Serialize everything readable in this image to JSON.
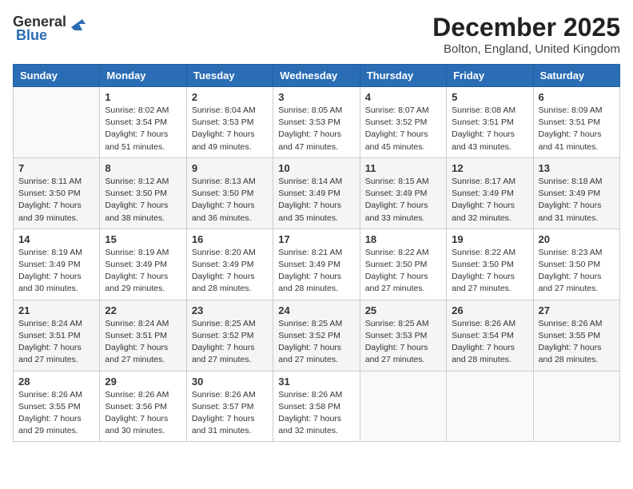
{
  "logo": {
    "general": "General",
    "blue": "Blue"
  },
  "title": "December 2025",
  "location": "Bolton, England, United Kingdom",
  "days": [
    "Sunday",
    "Monday",
    "Tuesday",
    "Wednesday",
    "Thursday",
    "Friday",
    "Saturday"
  ],
  "weeks": [
    [
      {
        "day": "",
        "sunrise": "",
        "sunset": "",
        "daylight": ""
      },
      {
        "day": "1",
        "sunrise": "Sunrise: 8:02 AM",
        "sunset": "Sunset: 3:54 PM",
        "daylight": "Daylight: 7 hours and 51 minutes."
      },
      {
        "day": "2",
        "sunrise": "Sunrise: 8:04 AM",
        "sunset": "Sunset: 3:53 PM",
        "daylight": "Daylight: 7 hours and 49 minutes."
      },
      {
        "day": "3",
        "sunrise": "Sunrise: 8:05 AM",
        "sunset": "Sunset: 3:53 PM",
        "daylight": "Daylight: 7 hours and 47 minutes."
      },
      {
        "day": "4",
        "sunrise": "Sunrise: 8:07 AM",
        "sunset": "Sunset: 3:52 PM",
        "daylight": "Daylight: 7 hours and 45 minutes."
      },
      {
        "day": "5",
        "sunrise": "Sunrise: 8:08 AM",
        "sunset": "Sunset: 3:51 PM",
        "daylight": "Daylight: 7 hours and 43 minutes."
      },
      {
        "day": "6",
        "sunrise": "Sunrise: 8:09 AM",
        "sunset": "Sunset: 3:51 PM",
        "daylight": "Daylight: 7 hours and 41 minutes."
      }
    ],
    [
      {
        "day": "7",
        "sunrise": "Sunrise: 8:11 AM",
        "sunset": "Sunset: 3:50 PM",
        "daylight": "Daylight: 7 hours and 39 minutes."
      },
      {
        "day": "8",
        "sunrise": "Sunrise: 8:12 AM",
        "sunset": "Sunset: 3:50 PM",
        "daylight": "Daylight: 7 hours and 38 minutes."
      },
      {
        "day": "9",
        "sunrise": "Sunrise: 8:13 AM",
        "sunset": "Sunset: 3:50 PM",
        "daylight": "Daylight: 7 hours and 36 minutes."
      },
      {
        "day": "10",
        "sunrise": "Sunrise: 8:14 AM",
        "sunset": "Sunset: 3:49 PM",
        "daylight": "Daylight: 7 hours and 35 minutes."
      },
      {
        "day": "11",
        "sunrise": "Sunrise: 8:15 AM",
        "sunset": "Sunset: 3:49 PM",
        "daylight": "Daylight: 7 hours and 33 minutes."
      },
      {
        "day": "12",
        "sunrise": "Sunrise: 8:17 AM",
        "sunset": "Sunset: 3:49 PM",
        "daylight": "Daylight: 7 hours and 32 minutes."
      },
      {
        "day": "13",
        "sunrise": "Sunrise: 8:18 AM",
        "sunset": "Sunset: 3:49 PM",
        "daylight": "Daylight: 7 hours and 31 minutes."
      }
    ],
    [
      {
        "day": "14",
        "sunrise": "Sunrise: 8:19 AM",
        "sunset": "Sunset: 3:49 PM",
        "daylight": "Daylight: 7 hours and 30 minutes."
      },
      {
        "day": "15",
        "sunrise": "Sunrise: 8:19 AM",
        "sunset": "Sunset: 3:49 PM",
        "daylight": "Daylight: 7 hours and 29 minutes."
      },
      {
        "day": "16",
        "sunrise": "Sunrise: 8:20 AM",
        "sunset": "Sunset: 3:49 PM",
        "daylight": "Daylight: 7 hours and 28 minutes."
      },
      {
        "day": "17",
        "sunrise": "Sunrise: 8:21 AM",
        "sunset": "Sunset: 3:49 PM",
        "daylight": "Daylight: 7 hours and 28 minutes."
      },
      {
        "day": "18",
        "sunrise": "Sunrise: 8:22 AM",
        "sunset": "Sunset: 3:50 PM",
        "daylight": "Daylight: 7 hours and 27 minutes."
      },
      {
        "day": "19",
        "sunrise": "Sunrise: 8:22 AM",
        "sunset": "Sunset: 3:50 PM",
        "daylight": "Daylight: 7 hours and 27 minutes."
      },
      {
        "day": "20",
        "sunrise": "Sunrise: 8:23 AM",
        "sunset": "Sunset: 3:50 PM",
        "daylight": "Daylight: 7 hours and 27 minutes."
      }
    ],
    [
      {
        "day": "21",
        "sunrise": "Sunrise: 8:24 AM",
        "sunset": "Sunset: 3:51 PM",
        "daylight": "Daylight: 7 hours and 27 minutes."
      },
      {
        "day": "22",
        "sunrise": "Sunrise: 8:24 AM",
        "sunset": "Sunset: 3:51 PM",
        "daylight": "Daylight: 7 hours and 27 minutes."
      },
      {
        "day": "23",
        "sunrise": "Sunrise: 8:25 AM",
        "sunset": "Sunset: 3:52 PM",
        "daylight": "Daylight: 7 hours and 27 minutes."
      },
      {
        "day": "24",
        "sunrise": "Sunrise: 8:25 AM",
        "sunset": "Sunset: 3:52 PM",
        "daylight": "Daylight: 7 hours and 27 minutes."
      },
      {
        "day": "25",
        "sunrise": "Sunrise: 8:25 AM",
        "sunset": "Sunset: 3:53 PM",
        "daylight": "Daylight: 7 hours and 27 minutes."
      },
      {
        "day": "26",
        "sunrise": "Sunrise: 8:26 AM",
        "sunset": "Sunset: 3:54 PM",
        "daylight": "Daylight: 7 hours and 28 minutes."
      },
      {
        "day": "27",
        "sunrise": "Sunrise: 8:26 AM",
        "sunset": "Sunset: 3:55 PM",
        "daylight": "Daylight: 7 hours and 28 minutes."
      }
    ],
    [
      {
        "day": "28",
        "sunrise": "Sunrise: 8:26 AM",
        "sunset": "Sunset: 3:55 PM",
        "daylight": "Daylight: 7 hours and 29 minutes."
      },
      {
        "day": "29",
        "sunrise": "Sunrise: 8:26 AM",
        "sunset": "Sunset: 3:56 PM",
        "daylight": "Daylight: 7 hours and 30 minutes."
      },
      {
        "day": "30",
        "sunrise": "Sunrise: 8:26 AM",
        "sunset": "Sunset: 3:57 PM",
        "daylight": "Daylight: 7 hours and 31 minutes."
      },
      {
        "day": "31",
        "sunrise": "Sunrise: 8:26 AM",
        "sunset": "Sunset: 3:58 PM",
        "daylight": "Daylight: 7 hours and 32 minutes."
      },
      {
        "day": "",
        "sunrise": "",
        "sunset": "",
        "daylight": ""
      },
      {
        "day": "",
        "sunrise": "",
        "sunset": "",
        "daylight": ""
      },
      {
        "day": "",
        "sunrise": "",
        "sunset": "",
        "daylight": ""
      }
    ]
  ]
}
